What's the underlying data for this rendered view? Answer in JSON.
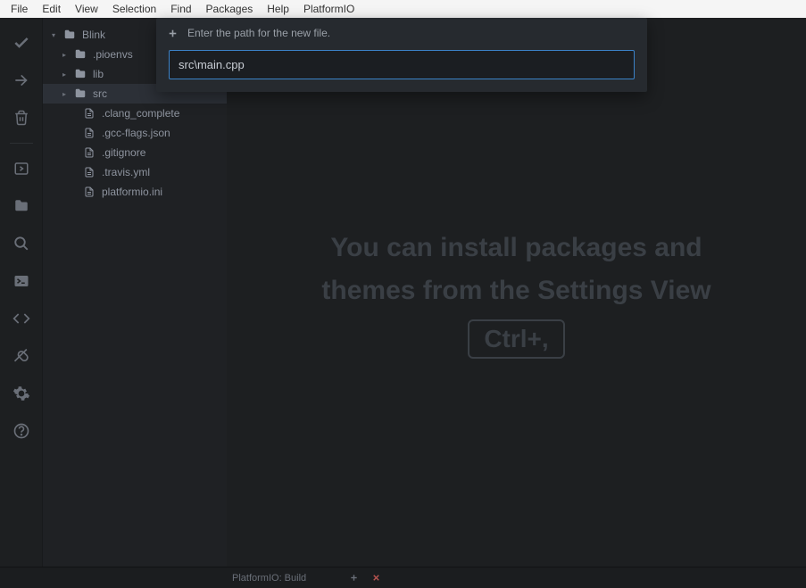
{
  "menu": [
    "File",
    "Edit",
    "View",
    "Selection",
    "Find",
    "Packages",
    "Help",
    "PlatformIO"
  ],
  "tree": {
    "root": "Blink",
    "folders": [
      ".pioenvs",
      "lib",
      "src"
    ],
    "files": [
      ".clang_complete",
      ".gcc-flags.json",
      ".gitignore",
      ".travis.yml",
      "platformio.ini"
    ]
  },
  "prompt": {
    "label": "Enter the path for the new file.",
    "value": "src\\main.cpp"
  },
  "welcome": {
    "line1": "You can install packages and",
    "line2": "themes from the Settings View",
    "shortcut": "Ctrl+,"
  },
  "status": {
    "label": "PlatformIO: Build"
  }
}
